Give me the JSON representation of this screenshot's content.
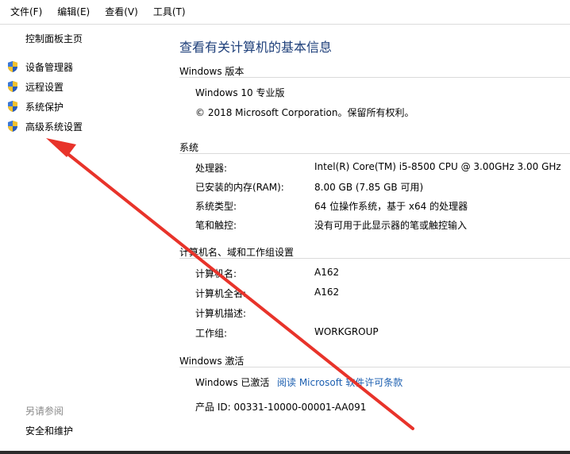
{
  "menubar": {
    "items": [
      "文件(F)",
      "编辑(E)",
      "查看(V)",
      "工具(T)"
    ]
  },
  "sidebar": {
    "home": "控制面板主页",
    "links": [
      "设备管理器",
      "远程设置",
      "系统保护",
      "高级系统设置"
    ],
    "see_also": "另请参阅",
    "security": "安全和维护"
  },
  "main": {
    "title": "查看有关计算机的基本信息",
    "edition": {
      "heading": "Windows 版本",
      "name": "Windows 10 专业版",
      "copyright": "© 2018 Microsoft Corporation。保留所有权利。"
    },
    "system": {
      "heading": "系统",
      "rows": [
        {
          "label": "处理器:",
          "value": "Intel(R) Core(TM) i5-8500 CPU @ 3.00GHz   3.00 GHz"
        },
        {
          "label": "已安装的内存(RAM):",
          "value": "8.00 GB (7.85 GB 可用)"
        },
        {
          "label": "系统类型:",
          "value": "64 位操作系统，基于 x64 的处理器"
        },
        {
          "label": "笔和触控:",
          "value": "没有可用于此显示器的笔或触控输入"
        }
      ]
    },
    "computer": {
      "heading": "计算机名、域和工作组设置",
      "rows": [
        {
          "label": "计算机名:",
          "value": "A162"
        },
        {
          "label": "计算机全名:",
          "value": "A162"
        },
        {
          "label": "计算机描述:",
          "value": ""
        },
        {
          "label": "工作组:",
          "value": "WORKGROUP"
        }
      ]
    },
    "activation": {
      "heading": "Windows 激活",
      "status": "Windows 已激活",
      "link": "阅读 Microsoft 软件许可条款",
      "product_id": "产品 ID: 00331-10000-00001-AA091"
    }
  },
  "colors": {
    "title": "#1e3f7a",
    "link": "#1c5fb0",
    "annotation_arrow": "#e8332a"
  },
  "icons": {
    "sidebar_link_icon": "uac-shield-icon"
  }
}
